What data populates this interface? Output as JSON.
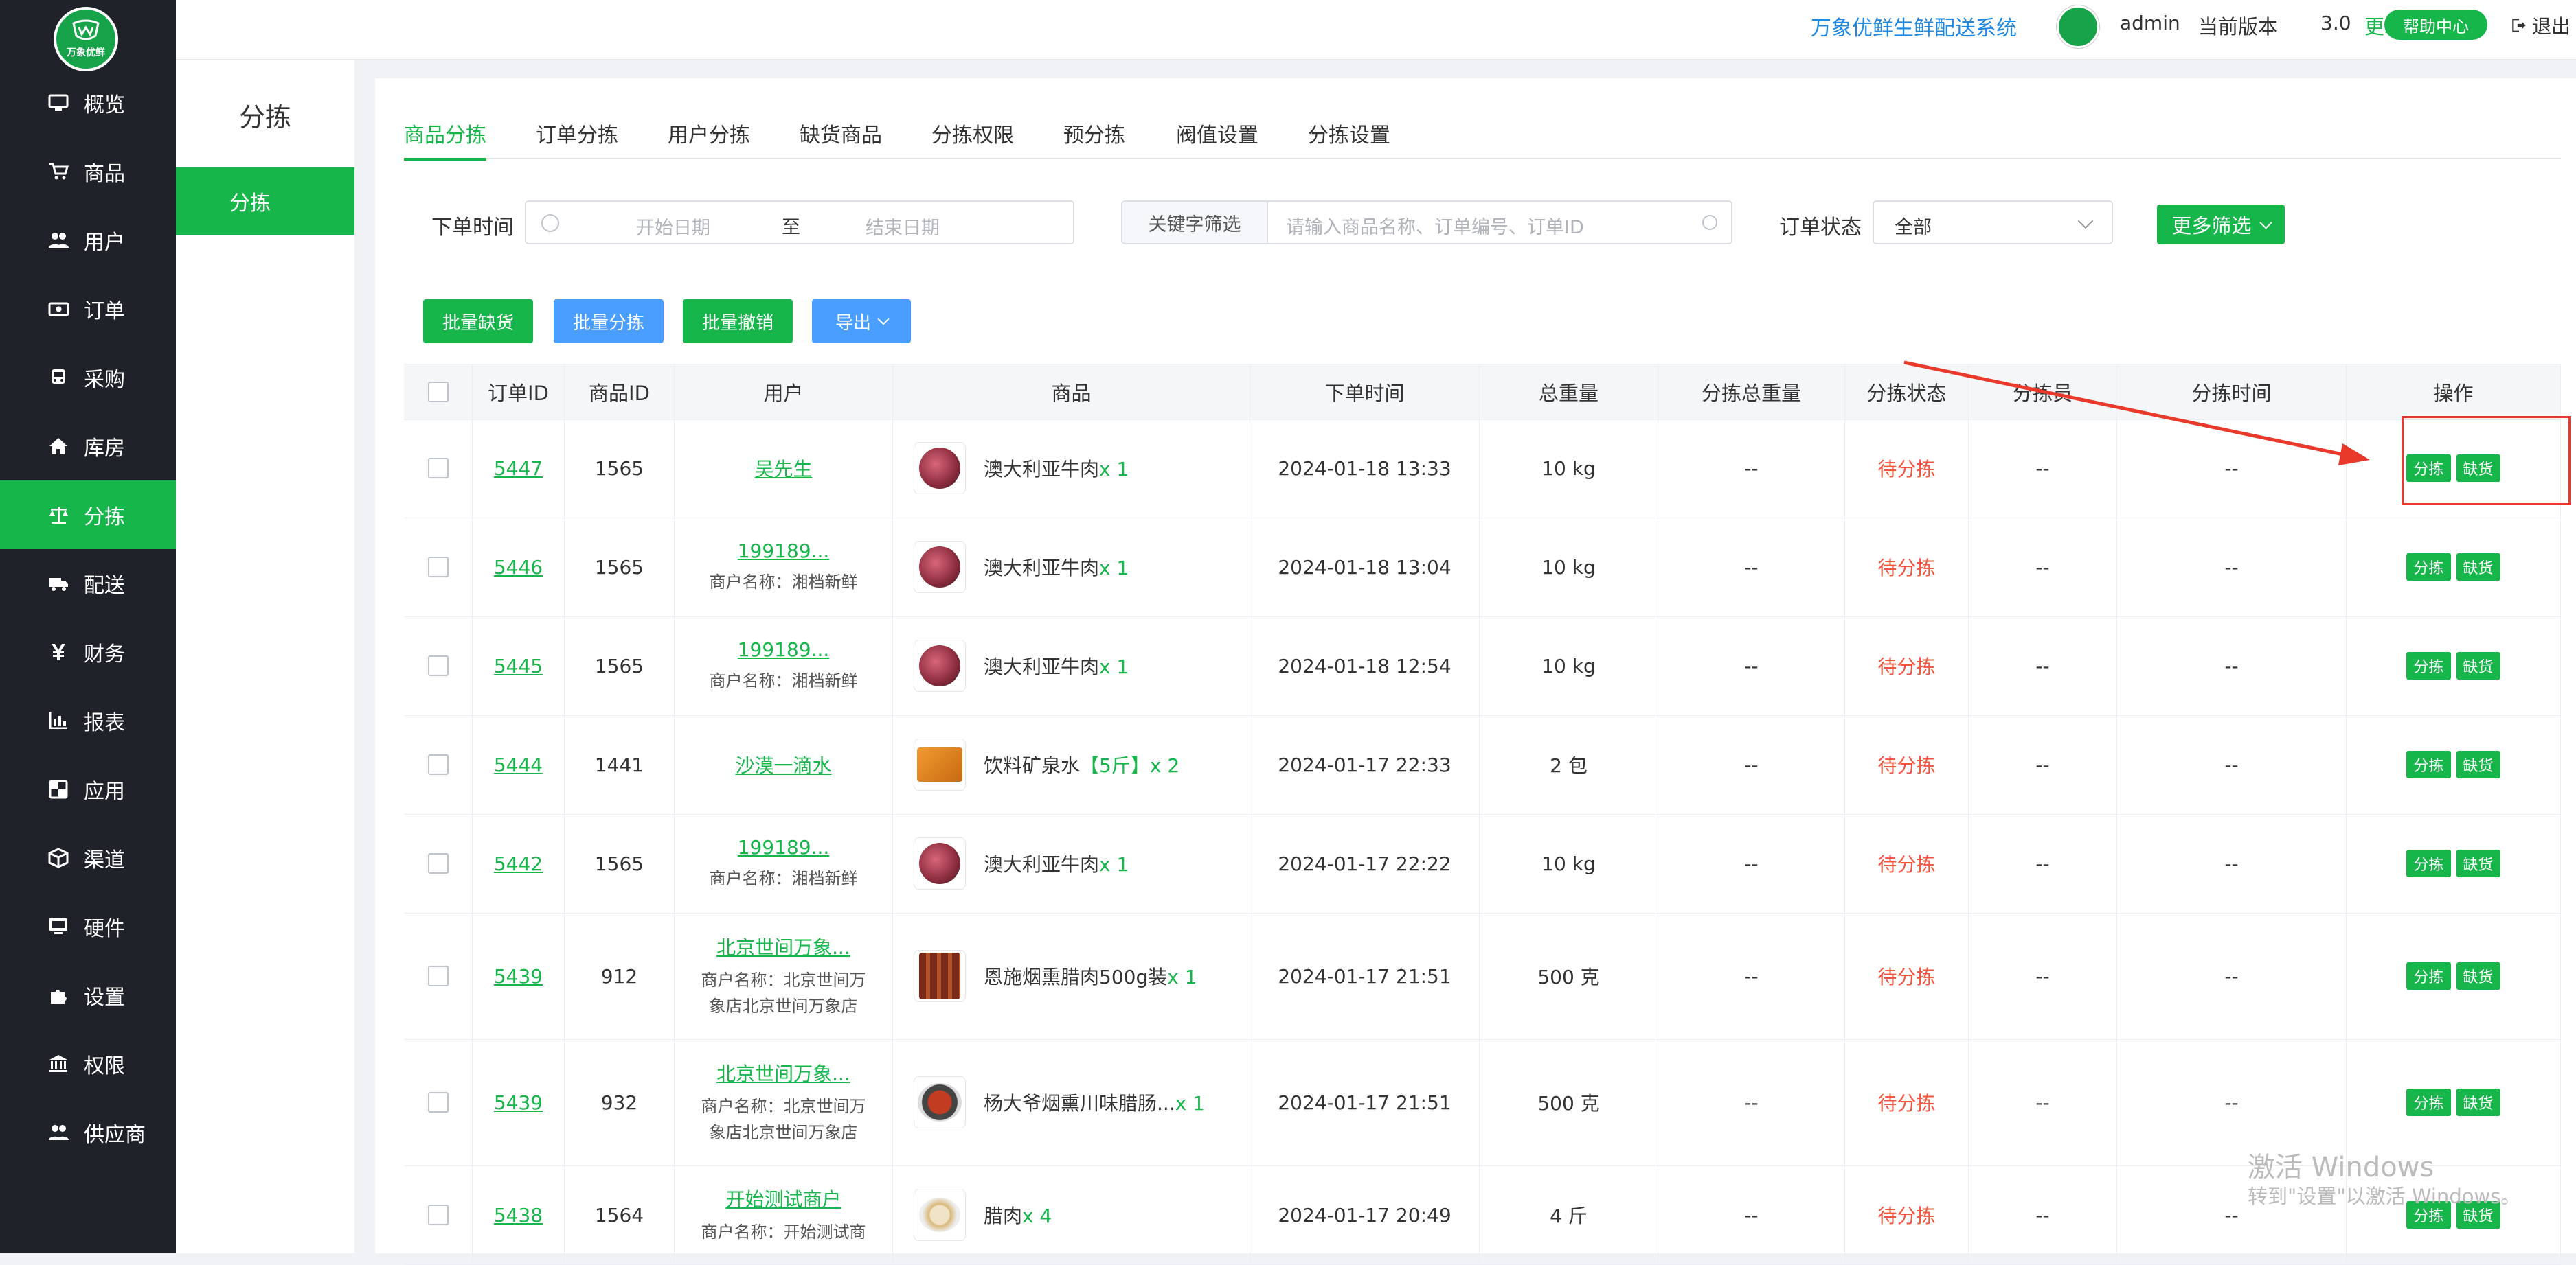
{
  "app": {
    "system_title": "万象优鲜生鲜配送系统",
    "logo_text": "万象优鲜",
    "user": "admin",
    "version_label": "当前版本",
    "version_number": "3.0",
    "update_label": "更新",
    "help_label": "帮助中心",
    "logout_label": "退出"
  },
  "sidebar": {
    "items": [
      {
        "label": "概览",
        "icon": "monitor-icon"
      },
      {
        "label": "商品",
        "icon": "cart-icon"
      },
      {
        "label": "用户",
        "icon": "users-icon"
      },
      {
        "label": "订单",
        "icon": "money-icon"
      },
      {
        "label": "采购",
        "icon": "bus-icon"
      },
      {
        "label": "库房",
        "icon": "home-icon"
      },
      {
        "label": "分拣",
        "icon": "scale-icon",
        "active": true
      },
      {
        "label": "配送",
        "icon": "truck-icon"
      },
      {
        "label": "财务",
        "icon": "yen-icon"
      },
      {
        "label": "报表",
        "icon": "bar-chart-icon"
      },
      {
        "label": "应用",
        "icon": "apps-icon"
      },
      {
        "label": "渠道",
        "icon": "cube-icon"
      },
      {
        "label": "硬件",
        "icon": "desktop-icon"
      },
      {
        "label": "设置",
        "icon": "puzzle-icon"
      },
      {
        "label": "权限",
        "icon": "bank-icon"
      },
      {
        "label": "供应商",
        "icon": "group-icon"
      }
    ]
  },
  "subnav": {
    "title": "分拣",
    "items": [
      {
        "label": "分拣",
        "active": true
      }
    ]
  },
  "tabs": [
    {
      "label": "商品分拣",
      "active": true
    },
    {
      "label": "订单分拣"
    },
    {
      "label": "用户分拣"
    },
    {
      "label": "缺货商品"
    },
    {
      "label": "分拣权限"
    },
    {
      "label": "预分拣"
    },
    {
      "label": "阀值设置"
    },
    {
      "label": "分拣设置"
    }
  ],
  "filters": {
    "order_time_label": "下单时间",
    "start_placeholder": "开始日期",
    "range_sep": "至",
    "end_placeholder": "结束日期",
    "keyword_label": "关键字筛选",
    "keyword_placeholder": "请输入商品名称、订单编号、订单ID",
    "status_label": "订单状态",
    "status_value": "全部",
    "more_label": "更多筛选"
  },
  "actions": {
    "batch_short": "批量缺货",
    "batch_sort": "批量分拣",
    "batch_revoke": "批量撤销",
    "export": "导出"
  },
  "table": {
    "columns": [
      "订单ID",
      "商品ID",
      "用户",
      "商品",
      "下单时间",
      "总重量",
      "分拣总重量",
      "分拣状态",
      "分拣员",
      "分拣时间",
      "操作"
    ],
    "sort_btn": "分拣",
    "short_btn": "缺货",
    "rows": [
      {
        "order_id": "5447",
        "goods_id": "1565",
        "user": "吴先生",
        "merchant": "",
        "goods": "澳大利亚牛肉",
        "spec": "",
        "qty": "x 1",
        "thumb": "meat",
        "time": "2024-01-18 13:33",
        "weight": "10 kg",
        "sorted_weight": "--",
        "status": "待分拣",
        "sorter": "--",
        "sort_time": "--"
      },
      {
        "order_id": "5446",
        "goods_id": "1565",
        "user": "199189...",
        "merchant": "商户名称：湘档新鲜",
        "goods": "澳大利亚牛肉",
        "spec": "",
        "qty": "x 1",
        "thumb": "meat",
        "time": "2024-01-18 13:04",
        "weight": "10 kg",
        "sorted_weight": "--",
        "status": "待分拣",
        "sorter": "--",
        "sort_time": "--"
      },
      {
        "order_id": "5445",
        "goods_id": "1565",
        "user": "199189...",
        "merchant": "商户名称：湘档新鲜",
        "goods": "澳大利亚牛肉",
        "spec": "",
        "qty": "x 1",
        "thumb": "meat",
        "time": "2024-01-18 12:54",
        "weight": "10 kg",
        "sorted_weight": "--",
        "status": "待分拣",
        "sorter": "--",
        "sort_time": "--"
      },
      {
        "order_id": "5444",
        "goods_id": "1441",
        "user": "沙漠一滴水",
        "merchant": "",
        "goods": "饮料矿泉水",
        "spec": "【5斤】",
        "qty": "x 2",
        "thumb": "water",
        "time": "2024-01-17 22:33",
        "weight": "2 包",
        "sorted_weight": "--",
        "status": "待分拣",
        "sorter": "--",
        "sort_time": "--"
      },
      {
        "order_id": "5442",
        "goods_id": "1565",
        "user": "199189...",
        "merchant": "商户名称：湘档新鲜",
        "goods": "澳大利亚牛肉",
        "spec": "",
        "qty": "x 1",
        "thumb": "meat",
        "time": "2024-01-17 22:22",
        "weight": "10 kg",
        "sorted_weight": "--",
        "status": "待分拣",
        "sorter": "--",
        "sort_time": "--"
      },
      {
        "order_id": "5439",
        "goods_id": "912",
        "user": "北京世间万象...",
        "merchant": "商户名称：北京世间万象店北京世间万象店",
        "goods": "恩施烟熏腊肉500g装",
        "spec": "",
        "qty": "x 1",
        "thumb": "sausage",
        "time": "2024-01-17 21:51",
        "weight": "500 克",
        "sorted_weight": "--",
        "status": "待分拣",
        "sorter": "--",
        "sort_time": "--"
      },
      {
        "order_id": "5439",
        "goods_id": "932",
        "user": "北京世间万象...",
        "merchant": "商户名称：北京世间万象店北京世间万象店",
        "goods": "杨大爷烟熏川味腊肠...",
        "spec": "",
        "qty": "x 1",
        "thumb": "pot",
        "time": "2024-01-17 21:51",
        "weight": "500 克",
        "sorted_weight": "--",
        "status": "待分拣",
        "sorter": "--",
        "sort_time": "--"
      },
      {
        "order_id": "5438",
        "goods_id": "1564",
        "user": "开始测试商户",
        "merchant": "商户名称：开始测试商",
        "goods": "腊肉",
        "spec": "",
        "qty": "x 4",
        "thumb": "bowl",
        "time": "2024-01-17 20:49",
        "weight": "4 斤",
        "sorted_weight": "--",
        "status": "待分拣",
        "sorter": "--",
        "sort_time": "--"
      }
    ]
  },
  "watermark": {
    "line1": "激活 Windows",
    "line2": "转到\"设置\"以激活 Windows。"
  },
  "colors": {
    "accent": "#16b64b",
    "sidebar_bg": "#1f2329",
    "blue": "#4a9eff",
    "pending": "#f5533d",
    "annotation": "#e8392b"
  }
}
